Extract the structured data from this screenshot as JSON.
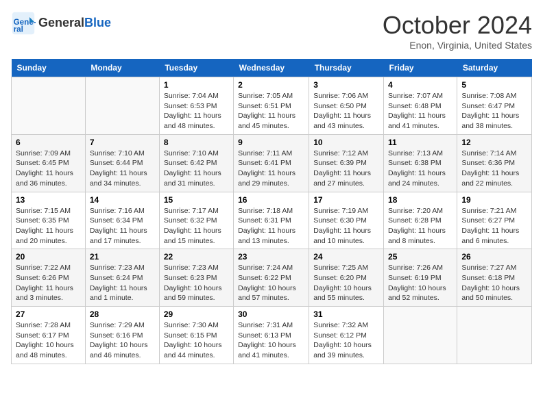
{
  "header": {
    "logo_general": "General",
    "logo_blue": "Blue",
    "month_title": "October 2024",
    "location": "Enon, Virginia, United States"
  },
  "days_of_week": [
    "Sunday",
    "Monday",
    "Tuesday",
    "Wednesday",
    "Thursday",
    "Friday",
    "Saturday"
  ],
  "weeks": [
    [
      {
        "day": "",
        "content": ""
      },
      {
        "day": "",
        "content": ""
      },
      {
        "day": "1",
        "content": "Sunrise: 7:04 AM\nSunset: 6:53 PM\nDaylight: 11 hours and 48 minutes."
      },
      {
        "day": "2",
        "content": "Sunrise: 7:05 AM\nSunset: 6:51 PM\nDaylight: 11 hours and 45 minutes."
      },
      {
        "day": "3",
        "content": "Sunrise: 7:06 AM\nSunset: 6:50 PM\nDaylight: 11 hours and 43 minutes."
      },
      {
        "day": "4",
        "content": "Sunrise: 7:07 AM\nSunset: 6:48 PM\nDaylight: 11 hours and 41 minutes."
      },
      {
        "day": "5",
        "content": "Sunrise: 7:08 AM\nSunset: 6:47 PM\nDaylight: 11 hours and 38 minutes."
      }
    ],
    [
      {
        "day": "6",
        "content": "Sunrise: 7:09 AM\nSunset: 6:45 PM\nDaylight: 11 hours and 36 minutes."
      },
      {
        "day": "7",
        "content": "Sunrise: 7:10 AM\nSunset: 6:44 PM\nDaylight: 11 hours and 34 minutes."
      },
      {
        "day": "8",
        "content": "Sunrise: 7:10 AM\nSunset: 6:42 PM\nDaylight: 11 hours and 31 minutes."
      },
      {
        "day": "9",
        "content": "Sunrise: 7:11 AM\nSunset: 6:41 PM\nDaylight: 11 hours and 29 minutes."
      },
      {
        "day": "10",
        "content": "Sunrise: 7:12 AM\nSunset: 6:39 PM\nDaylight: 11 hours and 27 minutes."
      },
      {
        "day": "11",
        "content": "Sunrise: 7:13 AM\nSunset: 6:38 PM\nDaylight: 11 hours and 24 minutes."
      },
      {
        "day": "12",
        "content": "Sunrise: 7:14 AM\nSunset: 6:36 PM\nDaylight: 11 hours and 22 minutes."
      }
    ],
    [
      {
        "day": "13",
        "content": "Sunrise: 7:15 AM\nSunset: 6:35 PM\nDaylight: 11 hours and 20 minutes."
      },
      {
        "day": "14",
        "content": "Sunrise: 7:16 AM\nSunset: 6:34 PM\nDaylight: 11 hours and 17 minutes."
      },
      {
        "day": "15",
        "content": "Sunrise: 7:17 AM\nSunset: 6:32 PM\nDaylight: 11 hours and 15 minutes."
      },
      {
        "day": "16",
        "content": "Sunrise: 7:18 AM\nSunset: 6:31 PM\nDaylight: 11 hours and 13 minutes."
      },
      {
        "day": "17",
        "content": "Sunrise: 7:19 AM\nSunset: 6:30 PM\nDaylight: 11 hours and 10 minutes."
      },
      {
        "day": "18",
        "content": "Sunrise: 7:20 AM\nSunset: 6:28 PM\nDaylight: 11 hours and 8 minutes."
      },
      {
        "day": "19",
        "content": "Sunrise: 7:21 AM\nSunset: 6:27 PM\nDaylight: 11 hours and 6 minutes."
      }
    ],
    [
      {
        "day": "20",
        "content": "Sunrise: 7:22 AM\nSunset: 6:26 PM\nDaylight: 11 hours and 3 minutes."
      },
      {
        "day": "21",
        "content": "Sunrise: 7:23 AM\nSunset: 6:24 PM\nDaylight: 11 hours and 1 minute."
      },
      {
        "day": "22",
        "content": "Sunrise: 7:23 AM\nSunset: 6:23 PM\nDaylight: 10 hours and 59 minutes."
      },
      {
        "day": "23",
        "content": "Sunrise: 7:24 AM\nSunset: 6:22 PM\nDaylight: 10 hours and 57 minutes."
      },
      {
        "day": "24",
        "content": "Sunrise: 7:25 AM\nSunset: 6:20 PM\nDaylight: 10 hours and 55 minutes."
      },
      {
        "day": "25",
        "content": "Sunrise: 7:26 AM\nSunset: 6:19 PM\nDaylight: 10 hours and 52 minutes."
      },
      {
        "day": "26",
        "content": "Sunrise: 7:27 AM\nSunset: 6:18 PM\nDaylight: 10 hours and 50 minutes."
      }
    ],
    [
      {
        "day": "27",
        "content": "Sunrise: 7:28 AM\nSunset: 6:17 PM\nDaylight: 10 hours and 48 minutes."
      },
      {
        "day": "28",
        "content": "Sunrise: 7:29 AM\nSunset: 6:16 PM\nDaylight: 10 hours and 46 minutes."
      },
      {
        "day": "29",
        "content": "Sunrise: 7:30 AM\nSunset: 6:15 PM\nDaylight: 10 hours and 44 minutes."
      },
      {
        "day": "30",
        "content": "Sunrise: 7:31 AM\nSunset: 6:13 PM\nDaylight: 10 hours and 41 minutes."
      },
      {
        "day": "31",
        "content": "Sunrise: 7:32 AM\nSunset: 6:12 PM\nDaylight: 10 hours and 39 minutes."
      },
      {
        "day": "",
        "content": ""
      },
      {
        "day": "",
        "content": ""
      }
    ]
  ]
}
